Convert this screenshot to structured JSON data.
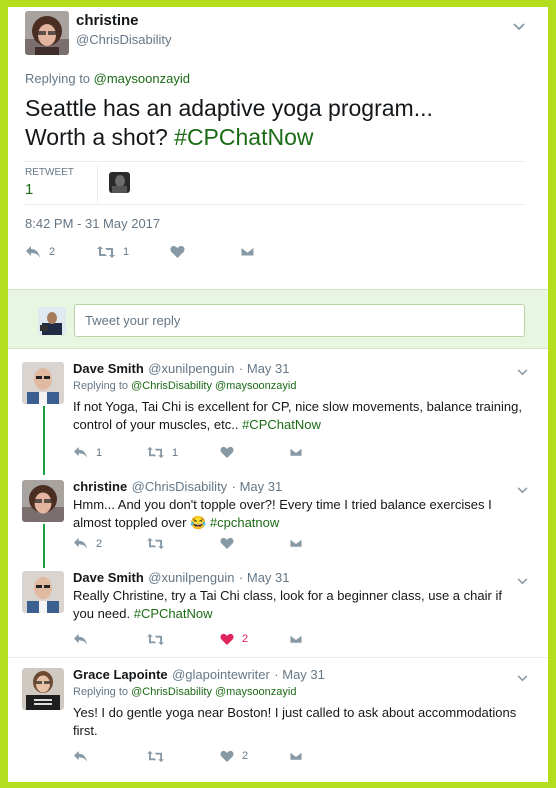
{
  "main_tweet": {
    "name": "christine",
    "handle": "@ChrisDisability",
    "replying_prefix": "Replying to ",
    "replying_to": "@maysoonzayid",
    "text_line1": "Seattle has an adaptive yoga program...",
    "text_line2": "Worth a shot? ",
    "hashtag": "#CPChatNow",
    "retweet_label": "RETWEET",
    "retweet_count": "1",
    "timestamp": "8:42 PM - 31 May 2017",
    "reply_count": "2",
    "rt_count": "1"
  },
  "composer": {
    "placeholder": "Tweet your reply"
  },
  "replies": [
    {
      "name": "Dave Smith",
      "handle": "@xunilpenguin",
      "time": "· May 31",
      "replying_prefix": "Replying to ",
      "replying_to": "@ChrisDisability @maysoonzayid",
      "line1": "If not Yoga, Tai Chi is excellent for CP, nice slow movements, balance training,",
      "line2": "control of your muscles, etc.. ",
      "hashtag": "#CPChatNow",
      "reply_count": "1",
      "rt_count": "1",
      "like_count": ""
    },
    {
      "name": "christine",
      "handle": "@ChrisDisability",
      "time": "· May 31",
      "line1": "Hmm... And you don't topple over?! Every time I tried balance exercises I",
      "line2": "almost toppled over ",
      "emoji": "😂",
      "hashtag": "#cpchatnow",
      "reply_count": "2",
      "rt_count": "",
      "like_count": ""
    },
    {
      "name": "Dave Smith",
      "handle": "@xunilpenguin",
      "time": "· May 31",
      "line1": "Really Christine, try a Tai Chi class, look for a beginner class, use a chair if",
      "line2": "you need. ",
      "hashtag": "#CPChatNow",
      "reply_count": "",
      "rt_count": "",
      "like_count": "2"
    },
    {
      "name": "Grace Lapointe",
      "handle": "@glapointewriter",
      "time": "· May 31",
      "replying_prefix": "Replying to ",
      "replying_to": "@ChrisDisability @maysoonzayid",
      "line1": "Yes! I do gentle yoga near Boston! I just called to ask about accommodations",
      "line2": "first.",
      "reply_count": "",
      "rt_count": "",
      "like_count": "2"
    }
  ],
  "icons": {
    "reply": "reply-arrow-icon",
    "retweet": "retweet-icon",
    "like": "heart-icon",
    "dm": "envelope-icon",
    "more": "chevron-down-icon"
  },
  "colors": {
    "frame": "#b4dd1e",
    "accent_green": "#1b6b16",
    "like_red": "#e0245e"
  }
}
